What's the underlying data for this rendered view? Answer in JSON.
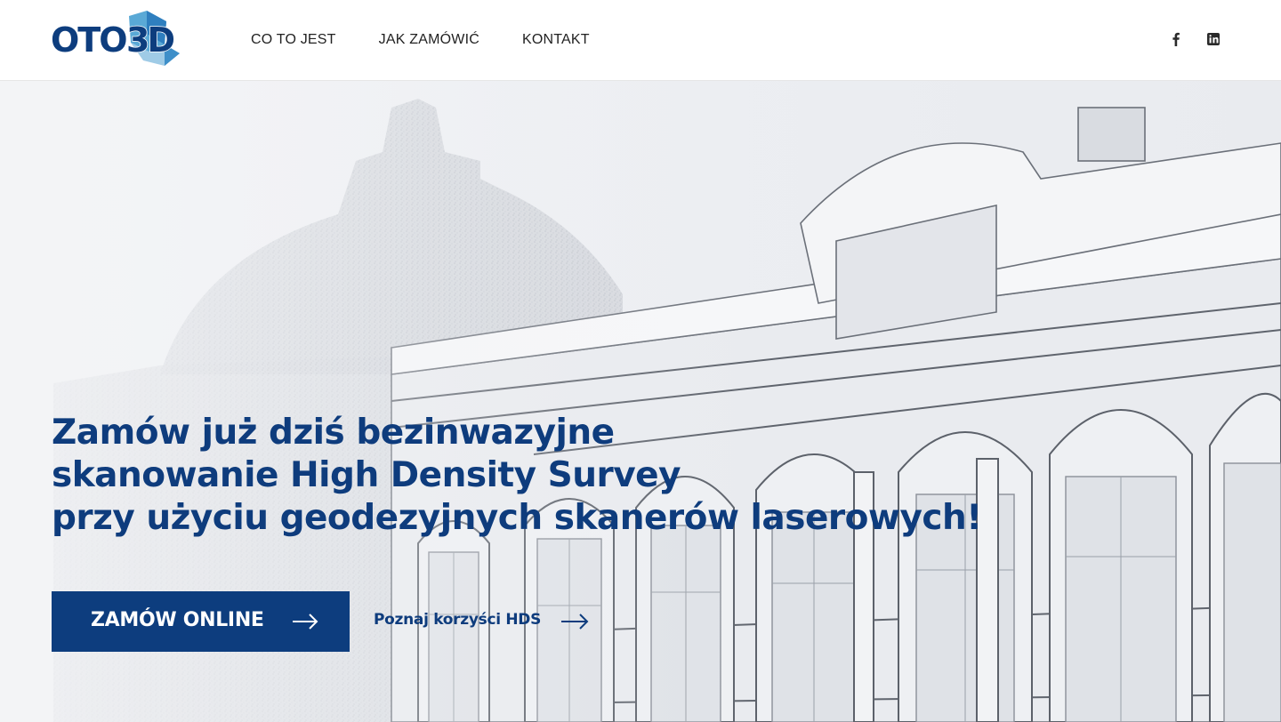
{
  "brand": {
    "logo_text": "OTO3D",
    "primary_color": "#0d3d7e",
    "accent_color": "#5aa9d6"
  },
  "nav": {
    "items": [
      {
        "label": "CO TO JEST"
      },
      {
        "label": "JAK ZAMÓWIĆ"
      },
      {
        "label": "KONTAKT"
      }
    ]
  },
  "social": {
    "icons": [
      "facebook-icon",
      "linkedin-icon"
    ]
  },
  "hero": {
    "headline_lines": [
      "Zamów już dziś bezinwazyjne",
      "skanowanie High Density Survey",
      "przy użyciu geodezyjnych skanerów laserowych!"
    ],
    "cta_label": "ZAMÓW ONLINE",
    "secondary_link_label": "Poznaj korzyści HDS"
  }
}
